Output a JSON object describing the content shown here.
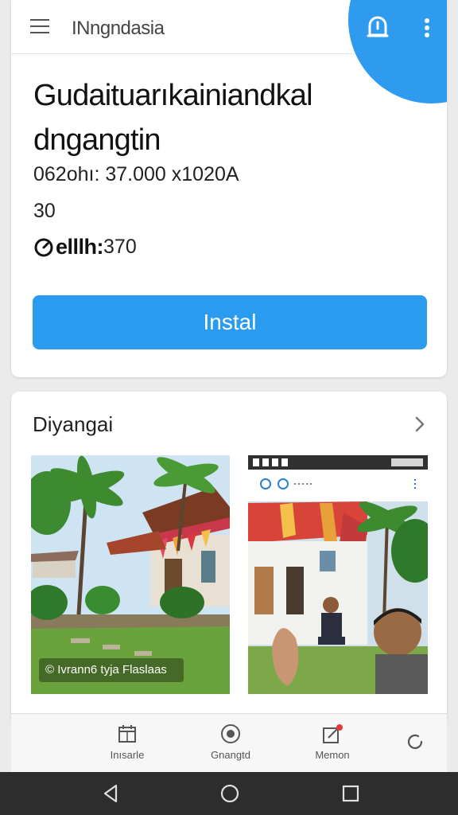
{
  "header": {
    "app_title": "INngndasia",
    "menu_icon": "menu-icon",
    "notification_icon": "bell-icon",
    "more_icon": "more-vert-icon",
    "accent_color": "#2f9bef"
  },
  "app_info": {
    "headline_line1": "Gudaituarıkainiandkal",
    "headline_line2": "dngangtin",
    "meta_line1": "062ohı: 37.000  x1020A",
    "meta_line2": "30",
    "meta_line3_bold": "elllh:",
    "meta_line3_value": "370",
    "install_label": "Instal",
    "install_color": "#2b9bf0"
  },
  "screenshots": {
    "title": "Diyangai",
    "caption": "© Ivrann6 tyja Flaslaas"
  },
  "bottom_nav": {
    "items": [
      {
        "label": "Inısarle",
        "icon": "calendar-grid-icon"
      },
      {
        "label": "Gnangtd",
        "icon": "globe-icon"
      },
      {
        "label": "Memon",
        "icon": "edit-badge-icon"
      },
      {
        "label": "",
        "icon": "refresh-icon"
      }
    ]
  },
  "system_nav": {
    "back_icon": "back-triangle-icon",
    "home_icon": "home-circle-icon",
    "recents_icon": "recents-square-icon"
  }
}
